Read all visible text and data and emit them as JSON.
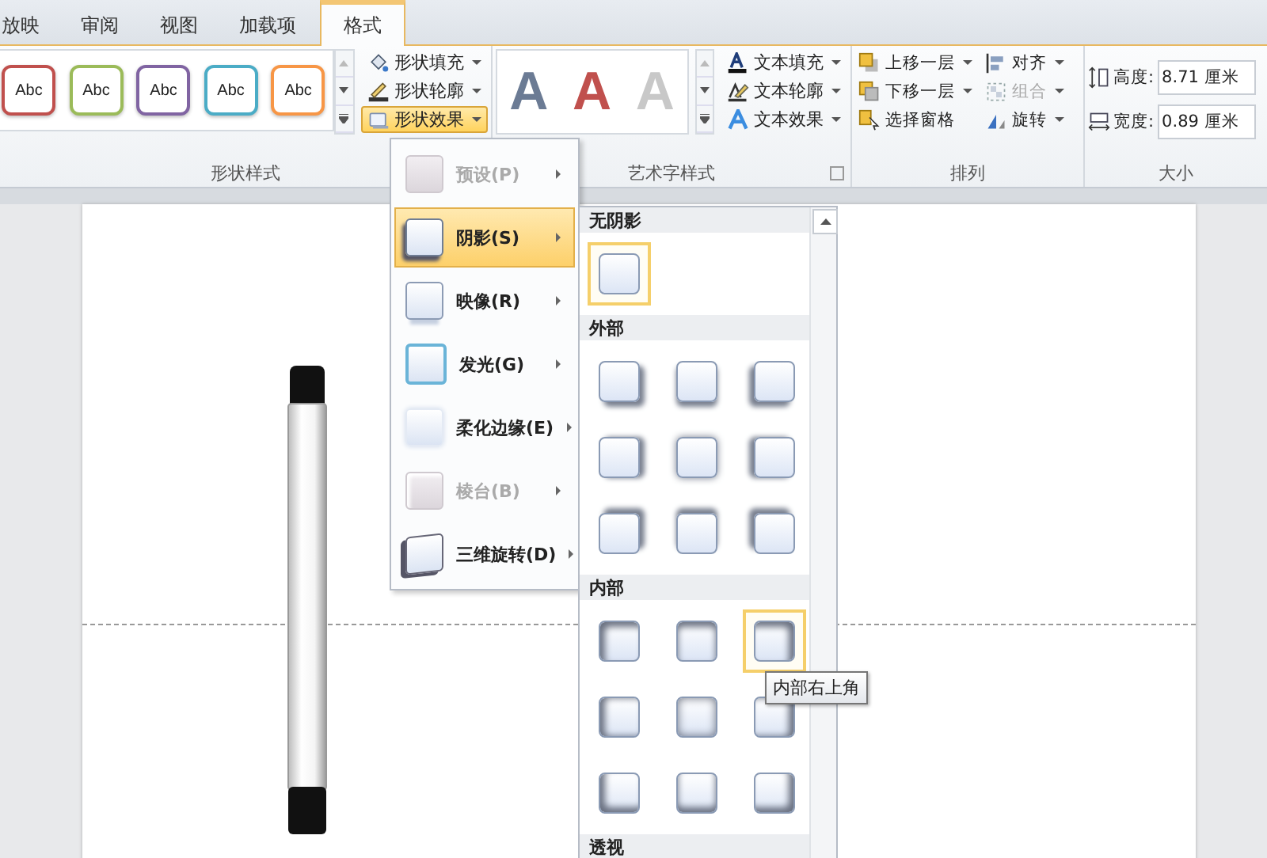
{
  "tabs": [
    {
      "label": "放映",
      "selected": false
    },
    {
      "label": "审阅",
      "selected": false
    },
    {
      "label": "视图",
      "selected": false
    },
    {
      "label": "加载项",
      "selected": false
    },
    {
      "label": "格式",
      "selected": true
    }
  ],
  "shape_styles": {
    "label": "形状样式",
    "presets": [
      {
        "label": "Abc",
        "color": "#c0504d"
      },
      {
        "label": "Abc",
        "color": "#9bbb59"
      },
      {
        "label": "Abc",
        "color": "#8064a2"
      },
      {
        "label": "Abc",
        "color": "#4bacc6"
      },
      {
        "label": "Abc",
        "color": "#f79646"
      }
    ],
    "commands": [
      {
        "kind": "fill",
        "label": "形状填充",
        "selected": false
      },
      {
        "kind": "outline",
        "label": "形状轮廓",
        "selected": false
      },
      {
        "kind": "effects",
        "label": "形状效果",
        "selected": true
      }
    ]
  },
  "wordart_styles": {
    "label": "艺术字样式",
    "samples": [
      {
        "label": "A",
        "color": "#6b7b94"
      },
      {
        "label": "A",
        "color": "#c0504d"
      },
      {
        "label": "A",
        "color": "#c8c8c8"
      }
    ],
    "commands": [
      {
        "kind": "fill",
        "label": "文本填充"
      },
      {
        "kind": "outline",
        "label": "文本轮廓"
      },
      {
        "kind": "effects",
        "label": "文本效果"
      }
    ]
  },
  "arrange": {
    "label": "排列",
    "commands": [
      {
        "kind": "forward",
        "label": "上移一层",
        "dropdown": true,
        "disabled": false
      },
      {
        "kind": "backward",
        "label": "下移一层",
        "dropdown": true,
        "disabled": false
      },
      {
        "kind": "pane",
        "label": "选择窗格",
        "dropdown": false,
        "disabled": false
      },
      {
        "kind": "align",
        "label": "对齐",
        "dropdown": true,
        "disabled": false
      },
      {
        "kind": "group",
        "label": "组合",
        "dropdown": true,
        "disabled": true
      },
      {
        "kind": "rotate",
        "label": "旋转",
        "dropdown": true,
        "disabled": false
      }
    ]
  },
  "size": {
    "label": "大小",
    "fields": [
      {
        "kind": "height",
        "label": "高度:",
        "value": "8.71 厘米"
      },
      {
        "kind": "width",
        "label": "宽度:",
        "value": "0.89 厘米"
      }
    ]
  },
  "effects_menu": [
    {
      "kind": "preset",
      "label": "预设(P)",
      "disabled": true,
      "selected": false
    },
    {
      "kind": "shadow",
      "label": "阴影(S)",
      "disabled": false,
      "selected": true
    },
    {
      "kind": "reflection",
      "label": "映像(R)",
      "disabled": false,
      "selected": false
    },
    {
      "kind": "glow",
      "label": "发光(G)",
      "disabled": false,
      "selected": false
    },
    {
      "kind": "soft",
      "label": "柔化边缘(E)",
      "disabled": false,
      "selected": false
    },
    {
      "kind": "bevel",
      "label": "棱台(B)",
      "disabled": true,
      "selected": false
    },
    {
      "kind": "rotation",
      "label": "三维旋转(D)",
      "disabled": false,
      "selected": false
    }
  ],
  "shadow_gallery": [
    {
      "kind": "none",
      "heading": "无阴影",
      "items": [
        {
          "selected": true
        }
      ]
    },
    {
      "kind": "outer",
      "heading": "外部",
      "items": [
        {
          "selected": false
        },
        {
          "selected": false
        },
        {
          "selected": false
        },
        {
          "selected": false
        },
        {
          "selected": false
        },
        {
          "selected": false
        },
        {
          "selected": false
        },
        {
          "selected": false
        },
        {
          "selected": false
        }
      ]
    },
    {
      "kind": "inner",
      "heading": "内部",
      "items": [
        {
          "selected": false
        },
        {
          "selected": false
        },
        {
          "selected": true
        },
        {
          "selected": false
        },
        {
          "selected": false
        },
        {
          "selected": false
        },
        {
          "selected": false
        },
        {
          "selected": false
        },
        {
          "selected": false
        }
      ]
    },
    {
      "kind": "perspective",
      "heading": "透视"
    }
  ],
  "tooltip": "内部右上角"
}
